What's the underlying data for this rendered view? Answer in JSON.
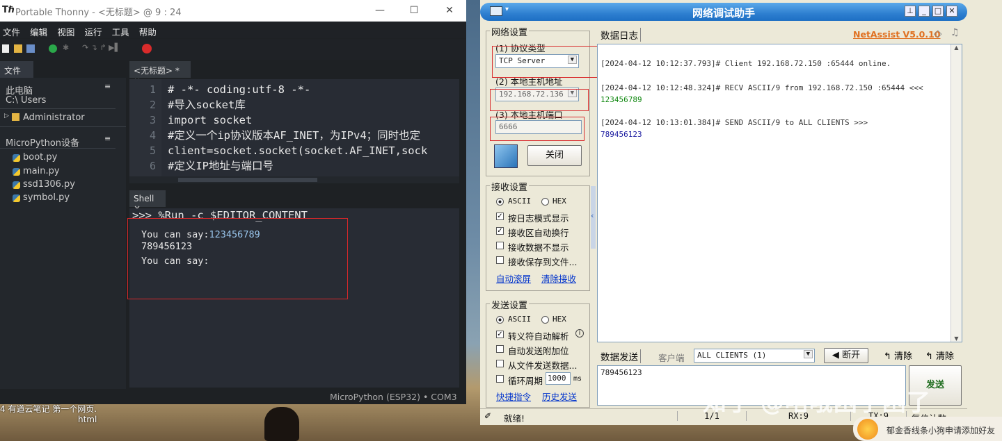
{
  "thonny": {
    "title": "Portable Thonny  -  <无标题>  @  9 : 24",
    "menu": [
      "文件",
      "编辑",
      "视图",
      "运行",
      "工具",
      "帮助"
    ],
    "files_tab": "文件 ×",
    "this_pc": "此电脑",
    "path": "C:\\ Users",
    "folder": "Administrator",
    "device_header": "MicroPython设备",
    "device_files": [
      "boot.py",
      "main.py",
      "ssd1306.py",
      "symbol.py"
    ],
    "editor_tab": "<无标题> * ×",
    "line_numbers": [
      "1",
      "2",
      "3",
      "4",
      "5",
      "6"
    ],
    "code_lines": [
      "# -*- coding:utf-8 -*-",
      "#导入socket库",
      "import socket",
      "#定义一个ip协议版本AF_INET，为IPv4；同时也定",
      "client=socket.socket(socket.AF_INET,sock",
      "#定义IP地址与端口号"
    ],
    "shell_tab": "Shell ×",
    "shell_prompt": ">>> %Run -c $EDITOR_CONTENT",
    "shell_out1_prefix": "You can say:",
    "shell_out1_value": "123456789",
    "shell_out2": "789456123",
    "shell_out3": "You can say:",
    "status": "MicroPython (ESP32)  •  COM3"
  },
  "netassist": {
    "title": "网络调试助手",
    "brand": "NetAssist V5.0.10",
    "net_settings": "网络设置",
    "protocol_label": "(1) 协议类型",
    "protocol_value": "TCP Server",
    "host_label": "(2) 本地主机地址",
    "host_value": "192.168.72.136",
    "port_label": "(3) 本地主机端口",
    "port_value": "6666",
    "close_btn": "关闭",
    "recv_settings": "接收设置",
    "ascii": "ASCII",
    "hex": "HEX",
    "recv_options": [
      {
        "label": "按日志模式显示",
        "checked": true
      },
      {
        "label": "接收区自动换行",
        "checked": true
      },
      {
        "label": "接收数据不显示",
        "checked": false
      },
      {
        "label": "接收保存到文件...",
        "checked": false
      }
    ],
    "auto_scroll": "自动滚屏",
    "clear_recv": "清除接收",
    "send_settings": "发送设置",
    "send_options": [
      {
        "label": "转义符自动解析",
        "checked": true
      },
      {
        "label": "自动发送附加位",
        "checked": false
      },
      {
        "label": "从文件发送数据...",
        "checked": false
      },
      {
        "label": "循环周期",
        "checked": false
      }
    ],
    "period_value": "1000",
    "period_unit": "ms",
    "shortcut": "快捷指令",
    "history": "历史发送",
    "log_tab": "数据日志",
    "log": [
      {
        "head": "[2024-04-12 10:12:37.793]# Client 192.168.72.150 :65444 online.",
        "body": ""
      },
      {
        "head": "[2024-04-12 10:12:48.324]# RECV ASCII/9 from 192.168.72.150 :65444 <<<",
        "body": "123456789"
      },
      {
        "head": "[2024-04-12 10:13:01.384]# SEND ASCII/9 to ALL CLIENTS >>>",
        "body": "789456123"
      }
    ],
    "send_tab": "数据发送",
    "client_label": "客户端",
    "client_value": "ALL CLIENTS (1)",
    "disconnect": "断开",
    "clear1": "清除",
    "clear2": "清除",
    "send_text": "789456123",
    "send_btn": "发送",
    "status_ready": "就绪!",
    "status_count": "1/1",
    "status_rx": "RX:9",
    "status_tx": "TX:9",
    "status_reset": "复位计数"
  },
  "desktop": {
    "taskbar_text": "4  有道云笔记    第一个网页.",
    "taskbar_text2": "html",
    "watermark": "知乎 @咯哦困了困了",
    "notify": "郁金香线条小狗申请添加好友"
  },
  "colors": {
    "recv": "#118811",
    "send": "#1a1aa0",
    "red_box": "#d8282a",
    "brand": "#e07020"
  }
}
